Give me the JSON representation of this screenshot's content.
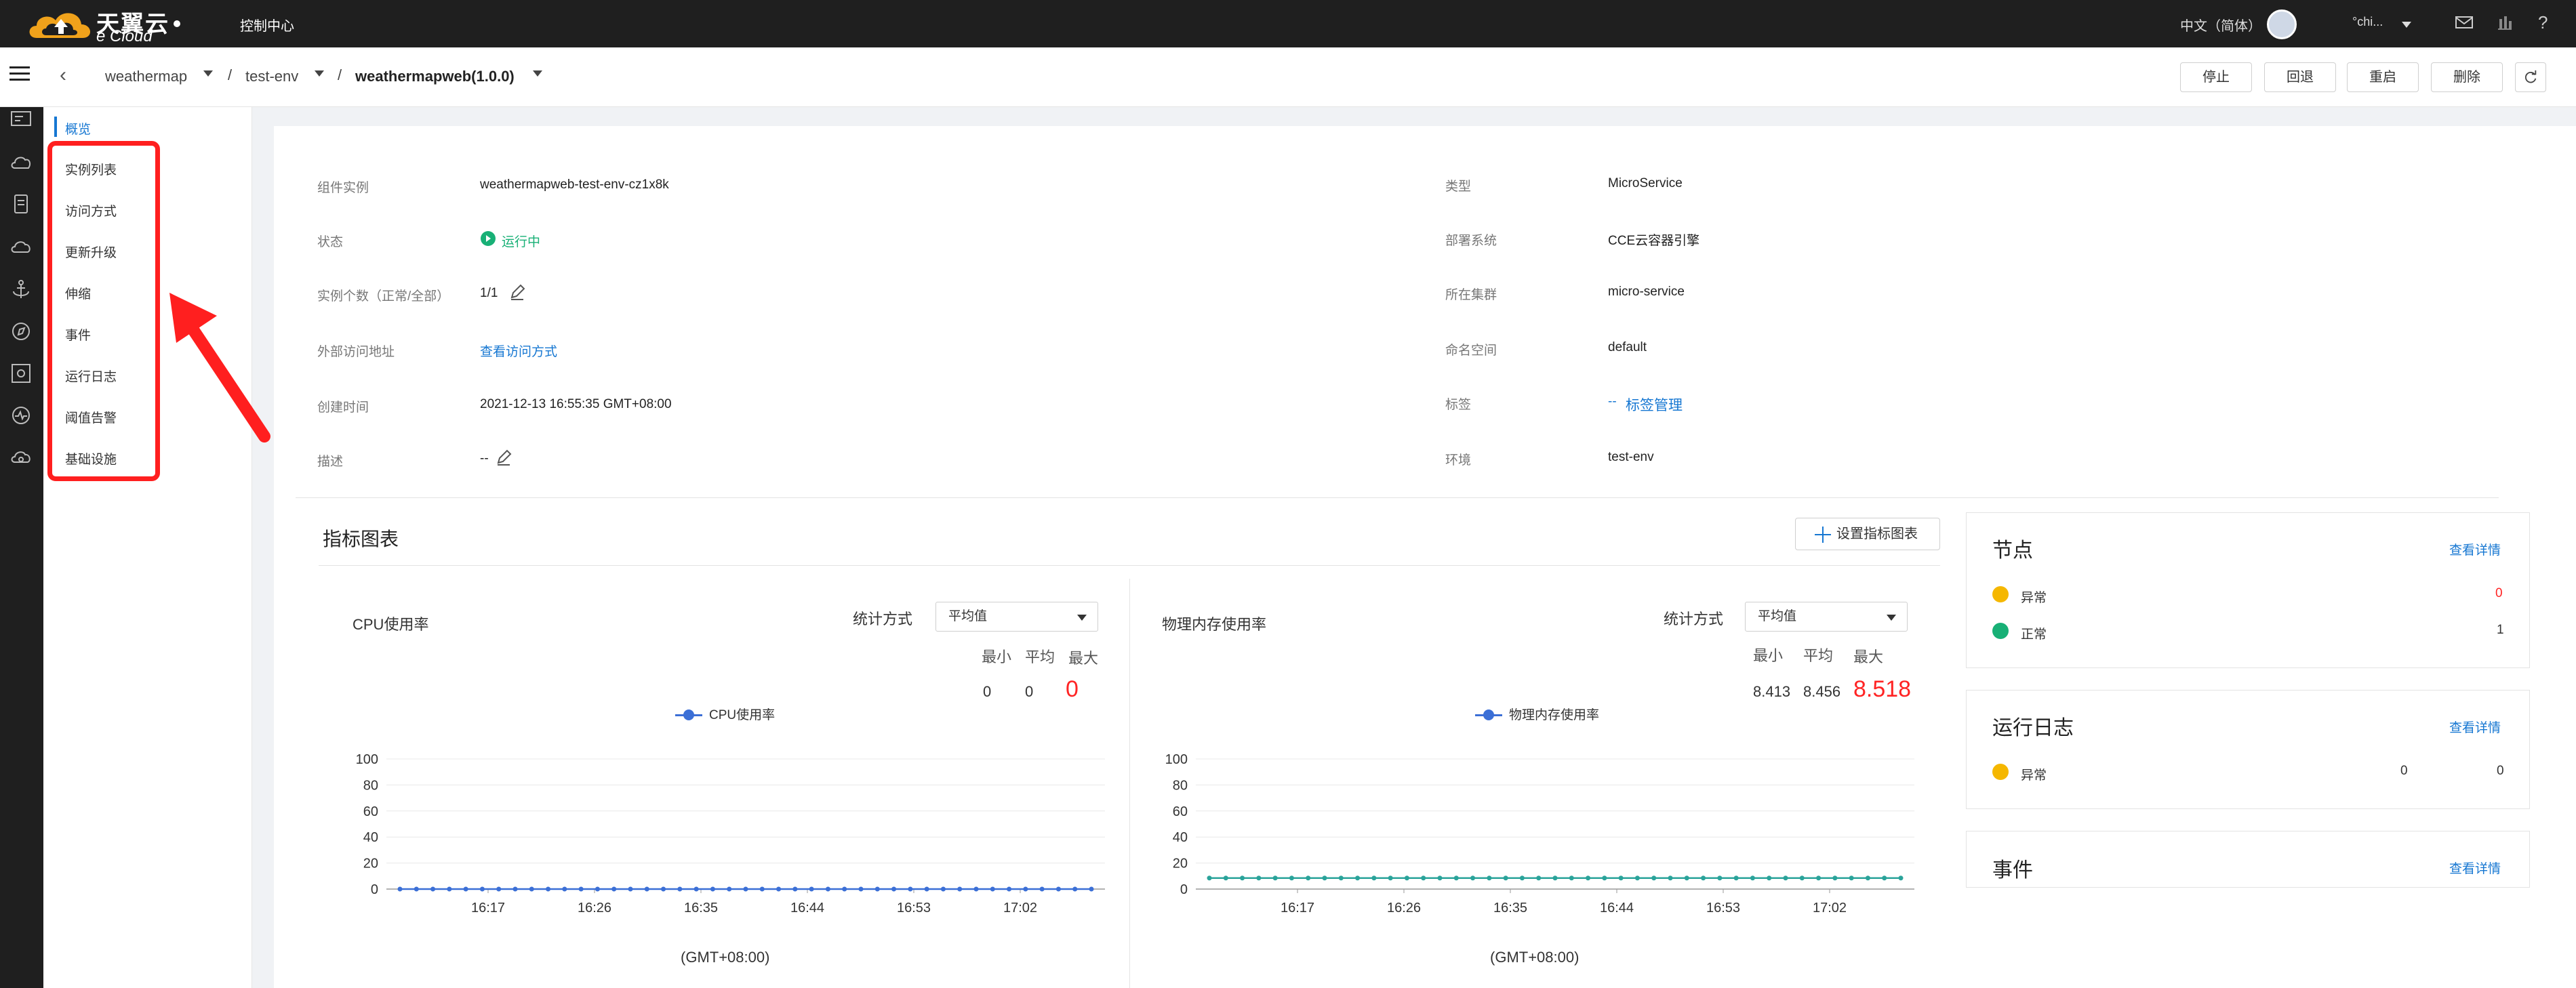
{
  "topbar": {
    "brand_cn": "天翼云",
    "brand_en": "e Cloud",
    "console": "控制中心",
    "language": "中文（简体）",
    "username": "°chi..."
  },
  "breadcrumb": {
    "app": "weathermap",
    "env": "test-env",
    "component": "weathermapweb(1.0.0)",
    "sep": "/"
  },
  "actions": {
    "stop": "停止",
    "rollback": "回退",
    "restart": "重启",
    "delete": "删除"
  },
  "subnav": {
    "overview": "概览",
    "items": [
      "实例列表",
      "访问方式",
      "更新升级",
      "伸缩",
      "事件",
      "运行日志",
      "阈值告警",
      "基础设施"
    ]
  },
  "info": {
    "left": [
      {
        "label": "组件实例",
        "value": "weathermapweb-test-env-cz1x8k"
      },
      {
        "label": "状态",
        "value": "运行中"
      },
      {
        "label": "实例个数（正常/全部）",
        "value": "1/1"
      },
      {
        "label": "外部访问地址",
        "value": "查看访问方式"
      },
      {
        "label": "创建时间",
        "value": "2021-12-13 16:55:35 GMT+08:00"
      },
      {
        "label": "描述",
        "value": "--"
      }
    ],
    "right": [
      {
        "label": "类型",
        "value": "MicroService"
      },
      {
        "label": "部署系统",
        "value": "CCE云容器引擎"
      },
      {
        "label": "所在集群",
        "value": "micro-service"
      },
      {
        "label": "命名空间",
        "value": "default"
      },
      {
        "label": "标签",
        "value": "--",
        "link": "标签管理"
      },
      {
        "label": "环境",
        "value": "test-env"
      }
    ]
  },
  "metrics": {
    "title": "指标图表",
    "config_button": "设置指标图表",
    "stat_label": "统计方式",
    "stat_value": "平均值",
    "min_label": "最小",
    "avg_label": "平均",
    "max_label": "最大",
    "cpu": {
      "title": "CPU使用率",
      "min": "0",
      "avg": "0",
      "max": "0",
      "legend": "CPU使用率"
    },
    "mem": {
      "title": "物理内存使用率",
      "min": "8.413",
      "avg": "8.456",
      "max": "8.518",
      "legend": "物理内存使用率"
    },
    "gmt": "(GMT+08:00)"
  },
  "chart_data": [
    {
      "type": "line",
      "title": "CPU使用率",
      "x": [
        "16:17",
        "16:26",
        "16:35",
        "16:44",
        "16:53",
        "17:02"
      ],
      "yticks": [
        "100",
        "80",
        "60",
        "40",
        "20",
        "0"
      ],
      "series": [
        {
          "name": "CPU使用率",
          "values": [
            0,
            0,
            0,
            0,
            0,
            0
          ]
        }
      ],
      "ylim": [
        0,
        100
      ],
      "xlabel": "(GMT+08:00)",
      "points": 43,
      "color": "#3b6fd6"
    },
    {
      "type": "line",
      "title": "物理内存使用率",
      "x": [
        "16:17",
        "16:26",
        "16:35",
        "16:44",
        "16:53",
        "17:02"
      ],
      "yticks": [
        "100",
        "80",
        "60",
        "40",
        "20",
        "0"
      ],
      "series": [
        {
          "name": "物理内存使用率",
          "values": [
            8.45,
            8.46,
            8.45,
            8.46,
            8.45,
            8.46
          ]
        }
      ],
      "ylim": [
        0,
        100
      ],
      "xlabel": "(GMT+08:00)",
      "points": 43,
      "color": "#2aa39a"
    }
  ],
  "cards": {
    "nodes": {
      "title": "节点",
      "link": "查看详情",
      "rows": [
        {
          "label": "异常",
          "value": "0"
        },
        {
          "label": "正常",
          "value": "1"
        }
      ]
    },
    "logs": {
      "title": "运行日志",
      "link": "查看详情",
      "row": {
        "label": "异常",
        "v1": "0",
        "v2": "0"
      }
    },
    "events": {
      "title": "事件",
      "link": "查看详情"
    }
  },
  "colors": {
    "accent": "#1677d2",
    "alert": "#ff2424",
    "ok": "#18b076",
    "warn": "#f5b700"
  }
}
